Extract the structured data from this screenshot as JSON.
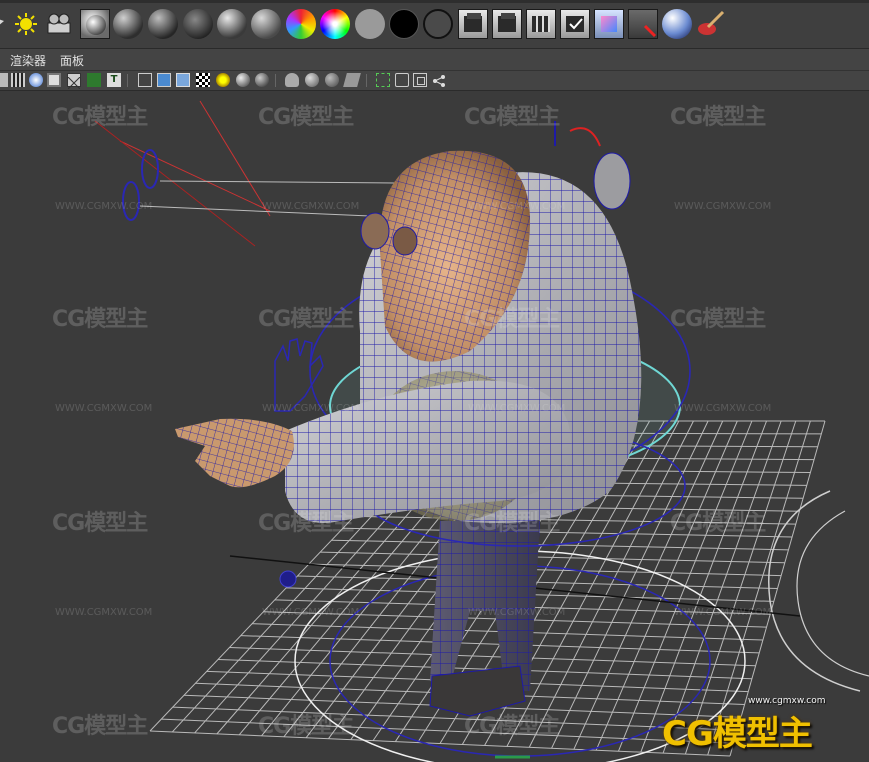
{
  "shelf": {
    "icons": [
      "partial-icon",
      "light-bulb-icon",
      "camera-group-icon",
      "render-sphere-icon",
      "shader-sphere-dark-icon",
      "shader-sphere-mid-icon",
      "shader-sphere-bump-icon",
      "shader-sphere-light-icon",
      "shader-sphere-gray-icon",
      "rainbow-sphere-icon",
      "color-wheel-icon",
      "gray-circle-icon",
      "black-circle-icon",
      "dark-circle-icon",
      "clapboard-icon",
      "clapboard-sequence-icon",
      "clapboard-grid-icon",
      "clapboard-check-icon",
      "render-settings-icon",
      "render-view-icon",
      "hypershade-icon",
      "paint-brush-icon"
    ]
  },
  "menu": {
    "renderer": "渲染器",
    "panels": "面板"
  },
  "panel_toolbar": {
    "icons": [
      "film-strip-icon",
      "camera-icon",
      "bookmark-icon",
      "grid-toggle-icon",
      "resolution-gate-icon",
      "text-icon",
      "wireframe-cube-icon",
      "shaded-cube-icon",
      "textured-cube-icon",
      "checker-icon",
      "light-icon",
      "shadow-sphere-icon",
      "ao-sphere-icon",
      "isolate-icon",
      "xray-sphere-icon",
      "xray-joint-icon",
      "xray-obj-icon",
      "select-highlight-icon",
      "component-icon",
      "hud-icon",
      "graph-icon"
    ]
  },
  "watermark": {
    "logo": "CG模型主",
    "url": "WWW.CGMXW.COM"
  },
  "brand": {
    "logo": "CG模型主",
    "url": "www.cgmxw.com"
  },
  "colors": {
    "background": "#3b3b3b",
    "wireframe": "#2a27b4",
    "grid": "#d0d0d0",
    "skin": "#c9996e",
    "suit": "#b8b8bc",
    "selection_ring": "#6fd7d4",
    "brand": "#f0c000"
  }
}
